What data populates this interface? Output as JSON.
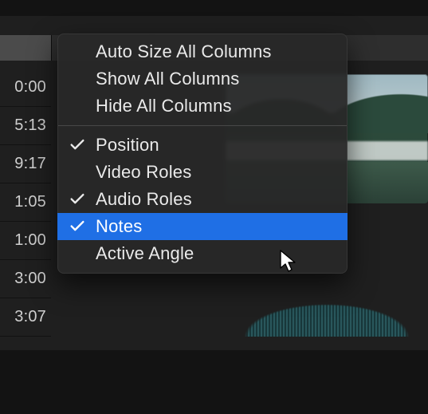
{
  "timeline": {
    "timecodes": [
      "0:00",
      "5:13",
      "9:17",
      "1:05",
      "1:00",
      "3:00",
      "3:07"
    ]
  },
  "menu": {
    "auto_size": "Auto Size All Columns",
    "show_all": "Show All Columns",
    "hide_all": "Hide All Columns",
    "columns": [
      {
        "key": "position",
        "label": "Position",
        "checked": true,
        "hover": false
      },
      {
        "key": "video_roles",
        "label": "Video Roles",
        "checked": false,
        "hover": false
      },
      {
        "key": "audio_roles",
        "label": "Audio Roles",
        "checked": true,
        "hover": false
      },
      {
        "key": "notes",
        "label": "Notes",
        "checked": true,
        "hover": true
      },
      {
        "key": "active_angle",
        "label": "Active Angle",
        "checked": false,
        "hover": false
      }
    ]
  },
  "colors": {
    "selection": "#1f6fe5"
  }
}
